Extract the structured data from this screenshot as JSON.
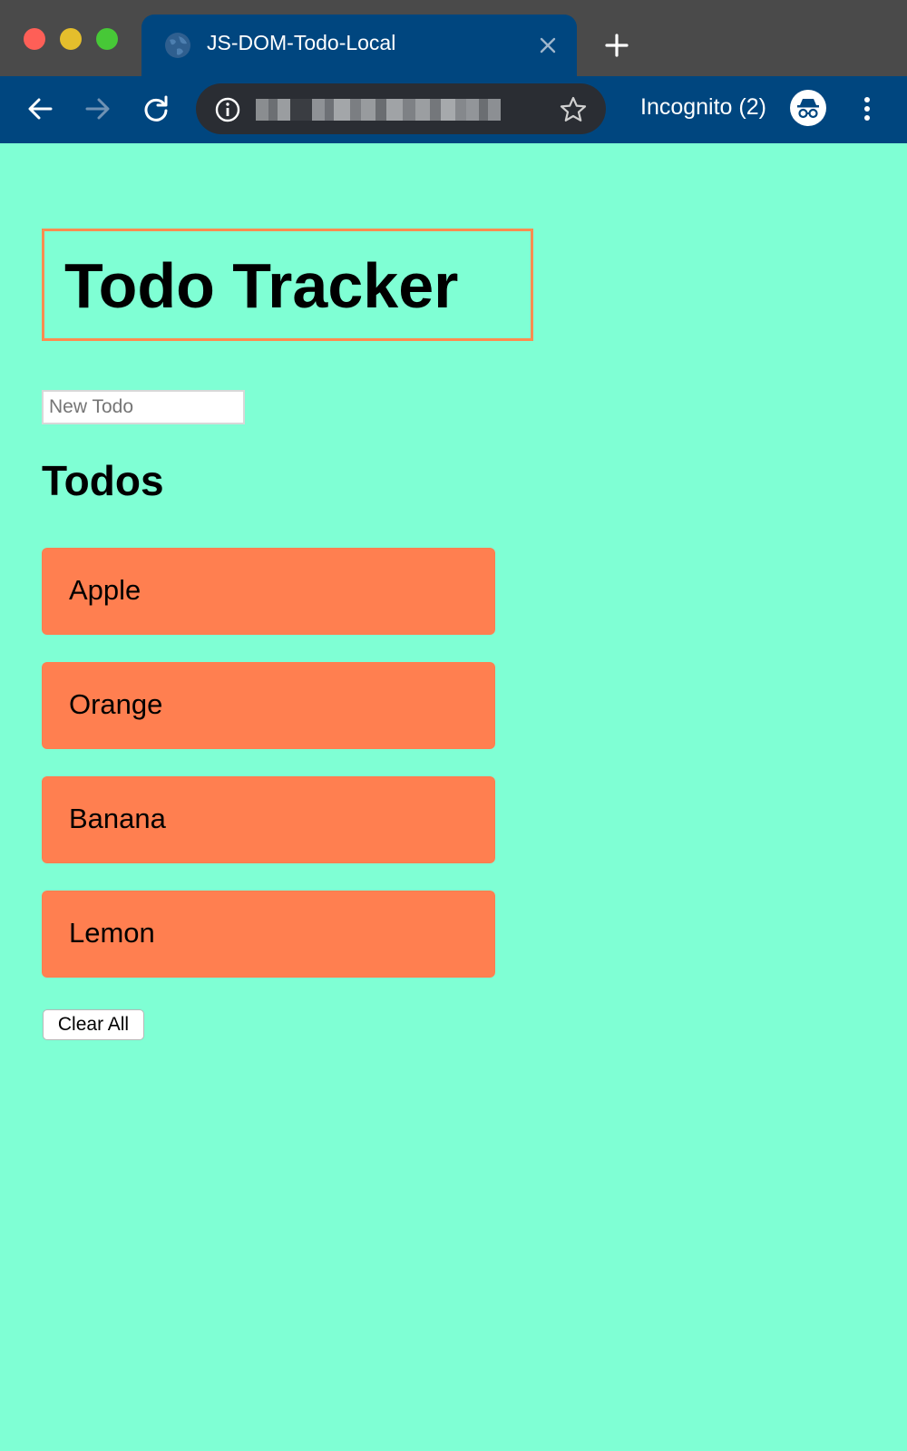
{
  "browser": {
    "tab_title": "JS-DOM-Todo-Local",
    "profile_label": "Incognito (2)",
    "colors": {
      "tabstrip": "#4a4a4a",
      "toolbar": "#00467f",
      "omnibox": "#2a2d33"
    }
  },
  "page": {
    "title": "Todo Tracker",
    "new_todo_placeholder": "New Todo",
    "new_todo_value": "",
    "todos_heading": "Todos",
    "todos": [
      {
        "label": "Apple"
      },
      {
        "label": "Orange"
      },
      {
        "label": "Banana"
      },
      {
        "label": "Lemon"
      }
    ],
    "clear_all_label": "Clear All",
    "colors": {
      "background": "#7fffd4",
      "todo_item": "#ff7f50",
      "title_border": "#ff8c50"
    }
  }
}
